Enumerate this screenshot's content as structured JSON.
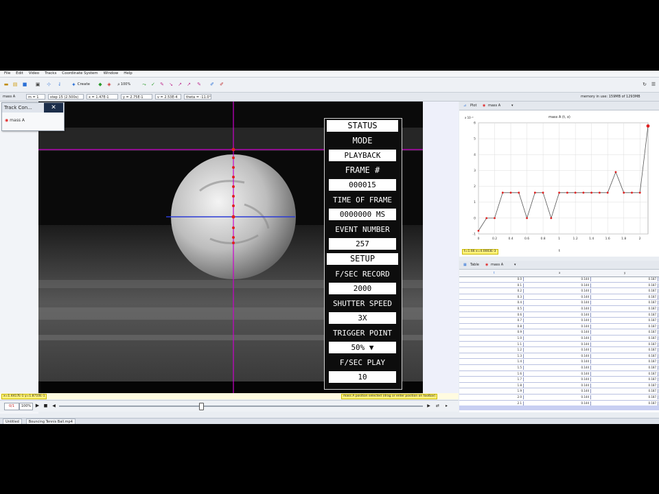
{
  "menu": [
    "File",
    "Edit",
    "Video",
    "Tracks",
    "Coordinate System",
    "Window",
    "Help"
  ],
  "toolbar": {
    "create_label": "Create",
    "zoom_label": "100%"
  },
  "toolbar2": {
    "track_label": "mass A",
    "mass_label": "m = 1",
    "step_label": "step 15 (2.500s)",
    "x_label": "x = 1.47E-1",
    "y_label": "y = 2.75E-1",
    "vel_label": "v = 2.53E-4",
    "theta_label": "theta = -11.0°",
    "memory_label": "memory in use: 159MB of 1293MB"
  },
  "track_control": {
    "title": "Track Con...",
    "close": "✕",
    "item": "mass A"
  },
  "hud": {
    "status": "STATUS",
    "mode": "MODE",
    "mode_value": "PLAYBACK",
    "frame": "FRAME #",
    "frame_value": "000015",
    "time_of_frame": "TIME OF FRAME",
    "time_value": "0000000 MS",
    "event_number": "EVENT NUMBER",
    "event_value": "257",
    "setup": "SETUP",
    "fsec_record": "F/SEC RECORD",
    "fsec_record_value": "2000",
    "shutter_speed": "SHUTTER SPEED",
    "shutter_value": "3X",
    "trigger_point": "TRIGGER POINT",
    "trigger_value": "50% ▼",
    "fsec_play": "F/SEC PLAY",
    "fsec_play_value": "10"
  },
  "video_status": {
    "coords": "x=1.4417E-1  y=1.8710E-1",
    "hint": "mass A position selected (drag or enter position on toolbar)"
  },
  "player": {
    "step_label": "0/1",
    "rate_label": "100%"
  },
  "plot_panel": {
    "tab_label": "Plot",
    "track_label": "mass A",
    "title": "mass A (t, x)",
    "x_axis_label": "t",
    "y_exp": "x 10⁻³",
    "coords": "t=1.66 x=4.0003E-3"
  },
  "table_panel": {
    "tab_label": "Table",
    "track_label": "mass A",
    "headers": [
      "t",
      "x",
      "y"
    ],
    "rows": [
      [
        "0.0",
        "0.144",
        "0.187"
      ],
      [
        "0.1",
        "0.144",
        "0.187"
      ],
      [
        "0.2",
        "0.144",
        "0.187"
      ],
      [
        "0.3",
        "0.144",
        "0.187"
      ],
      [
        "0.4",
        "0.144",
        "0.187"
      ],
      [
        "0.5",
        "0.144",
        "0.187"
      ],
      [
        "0.6",
        "0.144",
        "0.187"
      ],
      [
        "0.7",
        "0.144",
        "0.187"
      ],
      [
        "0.8",
        "0.144",
        "0.187"
      ],
      [
        "0.9",
        "0.144",
        "0.187"
      ],
      [
        "1.0",
        "0.144",
        "0.187"
      ],
      [
        "1.1",
        "0.144",
        "0.187"
      ],
      [
        "1.2",
        "0.144",
        "0.187"
      ],
      [
        "1.3",
        "0.144",
        "0.187"
      ],
      [
        "1.4",
        "0.144",
        "0.187"
      ],
      [
        "1.5",
        "0.144",
        "0.187"
      ],
      [
        "1.6",
        "0.144",
        "0.187"
      ],
      [
        "1.7",
        "0.144",
        "0.187"
      ],
      [
        "1.8",
        "0.144",
        "0.187"
      ],
      [
        "1.9",
        "0.144",
        "0.187"
      ],
      [
        "2.0",
        "0.144",
        "0.187"
      ],
      [
        "2.1",
        "0.144",
        "0.187"
      ]
    ]
  },
  "bottom_tabs": [
    "Untitled",
    "Bouncing Tennis Ball.mp4"
  ],
  "colors": {
    "accent": "#2a6fd6",
    "track": "#e02020",
    "axis": "#cc00cc",
    "tag_bg": "#fff27a"
  },
  "chart_data": {
    "type": "line",
    "title": "mass A (t, x)",
    "xlabel": "t",
    "ylabel": "x",
    "xlim": [
      0,
      2.1
    ],
    "ylim": [
      -1,
      6
    ],
    "xticks": [
      0,
      0.2,
      0.4,
      0.6,
      0.8,
      1.0,
      1.2,
      1.4,
      1.6,
      1.8,
      2.0
    ],
    "yticks": [
      -1,
      0,
      1,
      2,
      3,
      4,
      5,
      6
    ],
    "x": [
      0.0,
      0.1,
      0.2,
      0.3,
      0.4,
      0.5,
      0.6,
      0.7,
      0.8,
      0.9,
      1.0,
      1.1,
      1.2,
      1.3,
      1.4,
      1.5,
      1.6,
      1.7,
      1.8,
      1.9,
      2.0,
      2.1
    ],
    "values": [
      -0.8,
      0.0,
      0.0,
      1.6,
      1.6,
      1.6,
      0.0,
      1.6,
      1.6,
      0.0,
      1.6,
      1.6,
      1.6,
      1.6,
      1.6,
      1.6,
      1.6,
      2.9,
      1.6,
      1.6,
      1.6,
      5.8
    ],
    "grid": true
  }
}
